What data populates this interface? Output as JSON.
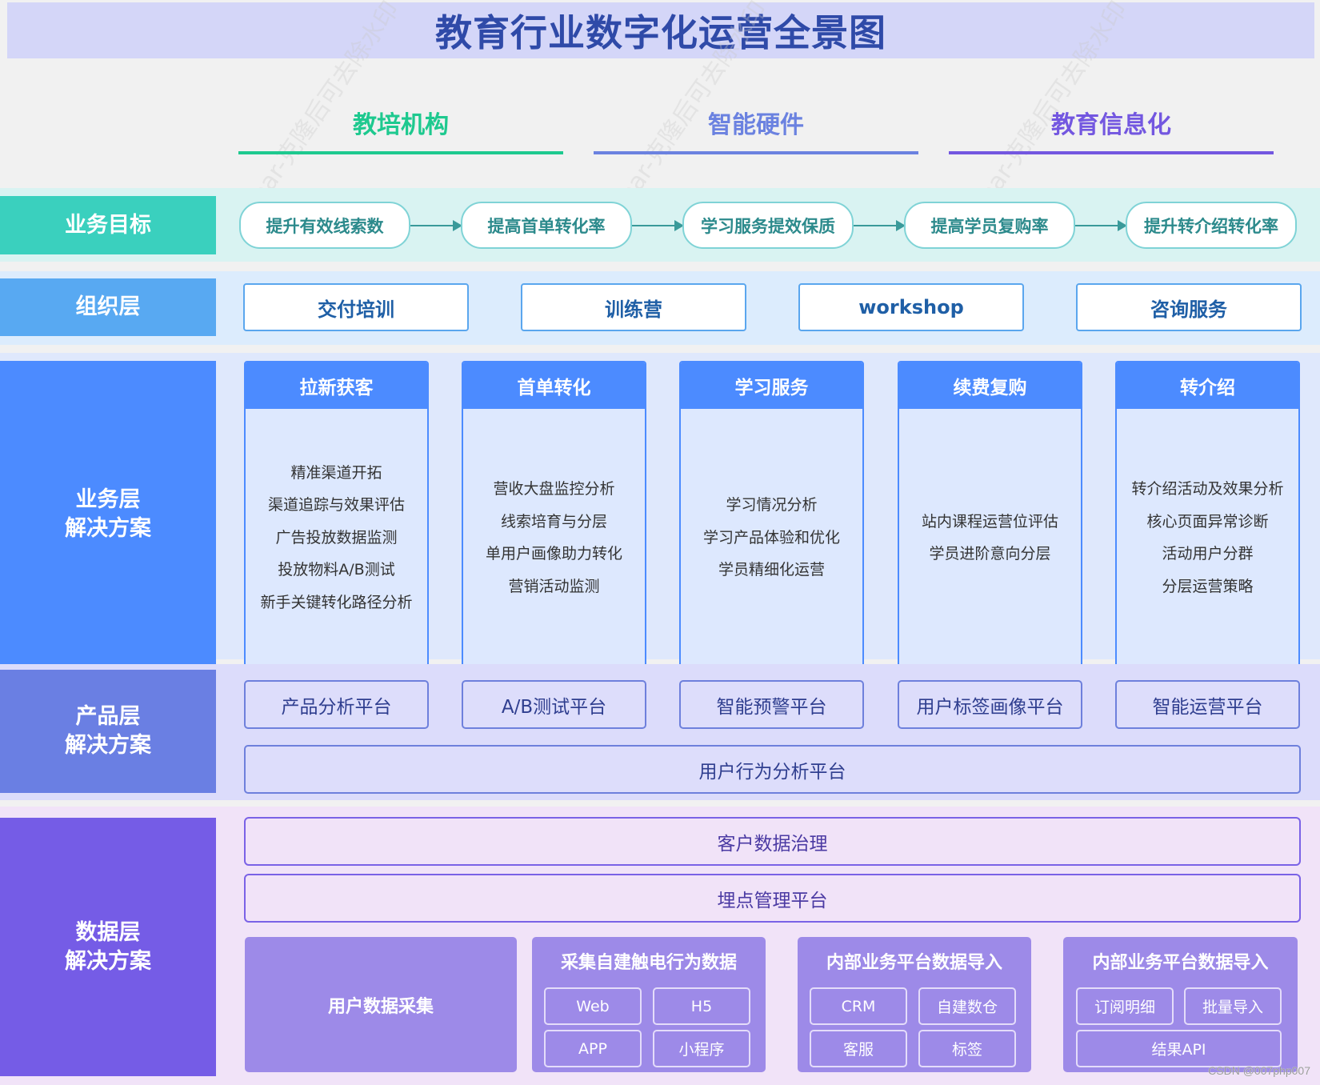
{
  "title": "教育行业数字化运营全景图",
  "columns": [
    {
      "label": "教培机构",
      "color": "#1ec98f"
    },
    {
      "label": "智能硬件",
      "color": "#6b82e0"
    },
    {
      "label": "教育信息化",
      "color": "#7357e0"
    }
  ],
  "watermark": "ear-克隆后可去除水印",
  "layers": {
    "goals": {
      "label": "业务目标",
      "color": "#3ad0be",
      "items": [
        "提升有效线索数",
        "提高首单转化率",
        "学习服务提效保质",
        "提高学员复购率",
        "提升转介绍转化率"
      ]
    },
    "org": {
      "label": "组织层",
      "color": "#58a9f2",
      "items": [
        "交付培训",
        "训练营",
        "workshop",
        "咨询服务"
      ]
    },
    "business": {
      "label_line1": "业务层",
      "label_line2": "解决方案",
      "color": "#4c8bff",
      "cards": [
        {
          "title": "拉新获客",
          "items": [
            "精准渠道开拓",
            "渠道追踪与效果评估",
            "广告投放数据监测",
            "投放物料A/B测试",
            "新手关键转化路径分析"
          ]
        },
        {
          "title": "首单转化",
          "items": [
            "营收大盘监控分析",
            "线索培育与分层",
            "单用户画像助力转化",
            "营销活动监测"
          ]
        },
        {
          "title": "学习服务",
          "items": [
            "学习情况分析",
            "学习产品体验和优化",
            "学员精细化运营"
          ]
        },
        {
          "title": "续费复购",
          "items": [
            "站内课程运营位评估",
            "学员进阶意向分层"
          ]
        },
        {
          "title": "转介绍",
          "items": [
            "转介绍活动及效果分析",
            "核心页面异常诊断",
            "活动用户分群",
            "分层运营策略"
          ]
        }
      ]
    },
    "product": {
      "label_line1": "产品层",
      "label_line2": "解决方案",
      "color": "#6a7fe3",
      "items": [
        "产品分析平台",
        "A/B测试平台",
        "智能预警平台",
        "用户标签画像平台",
        "智能运营平台"
      ],
      "wide": "用户行为分析平台"
    },
    "data": {
      "label_line1": "数据层",
      "label_line2": "解决方案",
      "color": "#755ce6",
      "rows": [
        "客户数据治理",
        "埋点管理平台"
      ],
      "collect": "用户数据采集",
      "groups": [
        {
          "title": "采集自建触电行为数据",
          "items": [
            "Web",
            "H5",
            "APP",
            "小程序"
          ]
        },
        {
          "title": "内部业务平台数据导入",
          "items": [
            "CRM",
            "自建数仓",
            "客服",
            "标签"
          ]
        },
        {
          "title": "内部业务平台数据导入",
          "items": [
            "订阅明细",
            "批量导入",
            "结果API"
          ]
        }
      ]
    }
  },
  "footer_mark": "CSDN @007php007"
}
